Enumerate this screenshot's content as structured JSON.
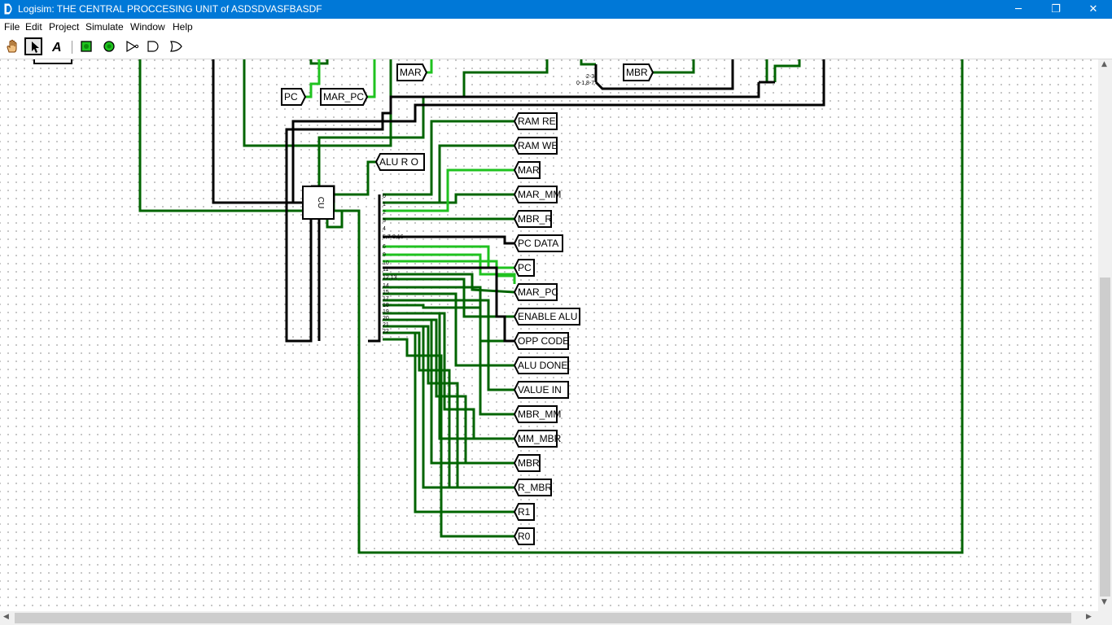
{
  "window": {
    "title": "Logisim: THE CENTRAL PROCCESING UNIT of ASDSDVASFBASDF",
    "controls": {
      "minimize": "─",
      "maximize": "❐",
      "close": "✕"
    }
  },
  "menu": [
    "File",
    "Edit",
    "Project",
    "Simulate",
    "Window",
    "Help"
  ],
  "toolbar": {
    "tools": [
      "hand-poke-icon",
      "arrow-select-icon",
      "text-tool-icon",
      "input-pin-icon",
      "output-pin-icon",
      "not-gate-icon",
      "and-gate-icon",
      "or-gate-icon"
    ],
    "selected": "arrow-select-icon"
  },
  "circuit": {
    "control_unit_label": "CU",
    "top_tunnels": [
      "PC",
      "MAR_PC",
      "MAR",
      "MBR"
    ],
    "alu_tunnel": "ALU R O",
    "splitter_top_labels": [
      "2-3",
      "0-1,8-7"
    ],
    "splitter_bits": [
      "0",
      "1",
      "2",
      "3",
      "4",
      "5,7-8,16",
      "6",
      "9",
      "10",
      "11",
      "12,13",
      "14",
      "15",
      "17",
      "18",
      "19",
      "20",
      "21",
      "22"
    ],
    "output_tunnels": [
      "RAM RE",
      "RAM WE",
      "MAR",
      "MAR_MM",
      "MBR_R",
      "PC DATA",
      "PC",
      "MAR_PC",
      "ENABLE ALU",
      "OPP CODE",
      "ALU DONE",
      "VALUE IN",
      "MBR_MM",
      "MM_MBR",
      "MBR",
      "R_MBR",
      "R1",
      "R0"
    ]
  },
  "colors": {
    "title_bar": "#0078d7",
    "wire_dark_green": "#006400",
    "wire_bright_green": "#1fc21f",
    "wire_bus_black": "#000000",
    "grid_dot": "#b7b7b7"
  }
}
